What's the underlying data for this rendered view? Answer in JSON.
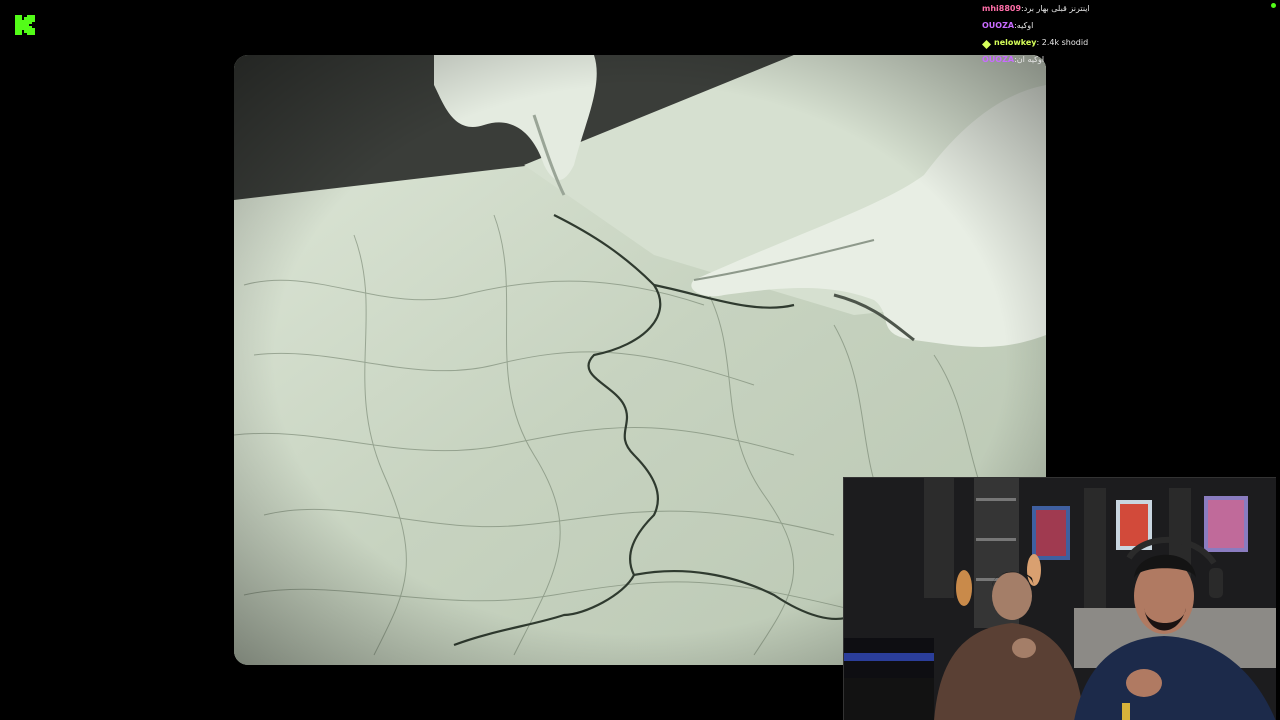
{
  "brand": {
    "logo_icon": "kick-logo-icon",
    "accent": "#53fc18"
  },
  "video": {
    "description_icon": "film-footage-map-icon"
  },
  "chat": {
    "messages": [
      {
        "user": "mhi8809",
        "text": ":اینترنز قبلی بهار برد",
        "color": "#ff6ea8",
        "badge": ""
      },
      {
        "user": "OUOZA",
        "text": ":اوکیه",
        "color": "#c86bff",
        "badge": ""
      },
      {
        "user": "nelowkey",
        "text": ": 2.4k shodid",
        "color": "#d6ff5a",
        "badge": "gem-badge-icon"
      },
      {
        "user": "OUOZA",
        "text": ":اوکیه ان",
        "color": "#c86bff",
        "badge": ""
      }
    ]
  },
  "status": {
    "live_indicator_icon": "live-dot-icon"
  },
  "webcam": {
    "icon": "webcam-feed-icon"
  }
}
